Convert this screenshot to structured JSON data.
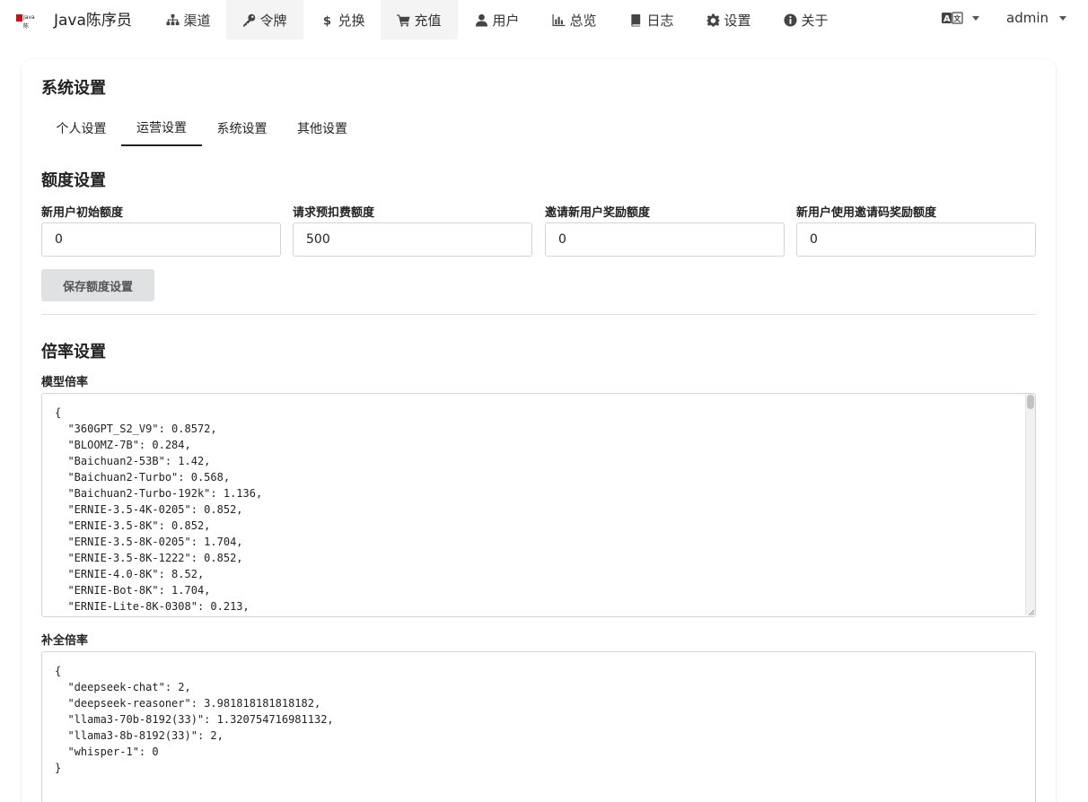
{
  "app": {
    "brand_logo_text": "Java陈",
    "brand_name": "Java陈序员"
  },
  "nav": {
    "items": [
      {
        "label": "渠道",
        "icon": "sitemap-icon"
      },
      {
        "label": "令牌",
        "icon": "key-icon"
      },
      {
        "label": "兑换",
        "icon": "dollar-icon"
      },
      {
        "label": "充值",
        "icon": "cart-icon"
      },
      {
        "label": "用户",
        "icon": "user-icon"
      },
      {
        "label": "总览",
        "icon": "bar-chart-icon"
      },
      {
        "label": "日志",
        "icon": "book-icon"
      },
      {
        "label": "设置",
        "icon": "gear-icon"
      },
      {
        "label": "关于",
        "icon": "info-icon"
      }
    ],
    "language_icon": "translate-icon",
    "user": "admin"
  },
  "page": {
    "title": "系统设置",
    "tabs": [
      {
        "label": "个人设置",
        "active": false
      },
      {
        "label": "运营设置",
        "active": true
      },
      {
        "label": "系统设置",
        "active": false
      },
      {
        "label": "其他设置",
        "active": false
      }
    ]
  },
  "quota": {
    "title": "额度设置",
    "fields": [
      {
        "label": "新用户初始额度",
        "value": "0"
      },
      {
        "label": "请求预扣费额度",
        "value": "500"
      },
      {
        "label": "邀请新用户奖励额度",
        "value": "0"
      },
      {
        "label": "新用户使用邀请码奖励额度",
        "value": "0"
      }
    ],
    "save_label": "保存额度设置"
  },
  "ratio": {
    "title": "倍率设置",
    "model_ratio_label": "模型倍率",
    "model_ratio_value": "{\n  \"360GPT_S2_V9\": 0.8572,\n  \"BLOOMZ-7B\": 0.284,\n  \"Baichuan2-53B\": 1.42,\n  \"Baichuan2-Turbo\": 0.568,\n  \"Baichuan2-Turbo-192k\": 1.136,\n  \"ERNIE-3.5-4K-0205\": 0.852,\n  \"ERNIE-3.5-8K\": 0.852,\n  \"ERNIE-3.5-8K-0205\": 1.704,\n  \"ERNIE-3.5-8K-1222\": 0.852,\n  \"ERNIE-4.0-8K\": 8.52,\n  \"ERNIE-Bot-8K\": 1.704,\n  \"ERNIE-Lite-8K-0308\": 0.213,",
    "completion_ratio_label": "补全倍率",
    "completion_ratio_value": "{\n  \"deepseek-chat\": 2,\n  \"deepseek-reasoner\": 3.981818181818182,\n  \"llama3-70b-8192(33)\": 1.320754716981132,\n  \"llama3-8b-8192(33)\": 2,\n  \"whisper-1\": 0\n}"
  }
}
